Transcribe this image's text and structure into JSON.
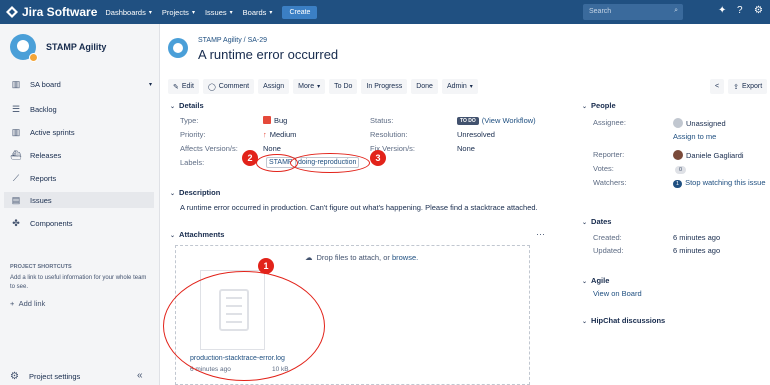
{
  "topnav": {
    "brand": "Jira Software",
    "items": [
      "Dashboards",
      "Projects",
      "Issues",
      "Boards"
    ],
    "create_label": "Create",
    "search_placeholder": "Search"
  },
  "sidebar": {
    "project_name": "STAMP Agility",
    "board": "SA board",
    "items": [
      {
        "label": "Backlog",
        "icon": "backlog-icon"
      },
      {
        "label": "Active sprints",
        "icon": "board-icon"
      },
      {
        "label": "Releases",
        "icon": "ship-icon"
      },
      {
        "label": "Reports",
        "icon": "chart-icon"
      },
      {
        "label": "Issues",
        "icon": "issues-icon",
        "active": true
      },
      {
        "label": "Components",
        "icon": "puzzle-icon"
      }
    ],
    "shortcuts_title": "PROJECT SHORTCUTS",
    "shortcuts_desc": "Add a link to useful information for your whole team to see.",
    "add_link": "Add link",
    "project_settings": "Project settings"
  },
  "issue": {
    "breadcrumb_project": "STAMP Agility",
    "breadcrumb_sep": "/",
    "key": "SA-29",
    "title": "A runtime error occurred"
  },
  "toolbar": {
    "edit": "Edit",
    "comment": "Comment",
    "assign": "Assign",
    "more": "More",
    "todo": "To Do",
    "inprogress": "In Progress",
    "done": "Done",
    "admin": "Admin",
    "export": "Export"
  },
  "details": {
    "heading": "Details",
    "type_label": "Type:",
    "type_value": "Bug",
    "priority_label": "Priority:",
    "priority_value": "Medium",
    "affects_label": "Affects Version/s:",
    "affects_value": "None",
    "labels_label": "Labels:",
    "labels": [
      "STAMP",
      "doing-reproduction"
    ],
    "status_label": "Status:",
    "status_badge": "TO DO",
    "status_link": "(View Workflow)",
    "resolution_label": "Resolution:",
    "resolution_value": "Unresolved",
    "fix_label": "Fix Version/s:",
    "fix_value": "None"
  },
  "description": {
    "heading": "Description",
    "text": "A runtime error occurred in production. Can't figure out what's happening. Please find a stacktrace attached."
  },
  "attachments": {
    "heading": "Attachments",
    "drop_text": "Drop files to attach, or",
    "browse": "browse.",
    "file_name": "production-stacktrace-error.log",
    "file_time": "6 minutes ago",
    "file_size": "10 kB"
  },
  "people": {
    "heading": "People",
    "assignee_label": "Assignee:",
    "assignee_value": "Unassigned",
    "assign_to_me": "Assign to me",
    "reporter_label": "Reporter:",
    "reporter_value": "Daniele Gagliardi",
    "votes_label": "Votes:",
    "votes_value": "0",
    "watchers_label": "Watchers:",
    "watchers_count": "1",
    "watchers_link": "Stop watching this issue"
  },
  "dates": {
    "heading": "Dates",
    "created_label": "Created:",
    "created_value": "6 minutes ago",
    "updated_label": "Updated:",
    "updated_value": "6 minutes ago"
  },
  "agile": {
    "heading": "Agile",
    "link": "View on Board"
  },
  "hipchat": {
    "heading": "HipChat discussions"
  },
  "callouts": [
    "1",
    "2",
    "3"
  ],
  "colors": {
    "nav": "#205081",
    "callout": "#e2231a",
    "link": "#205081"
  }
}
